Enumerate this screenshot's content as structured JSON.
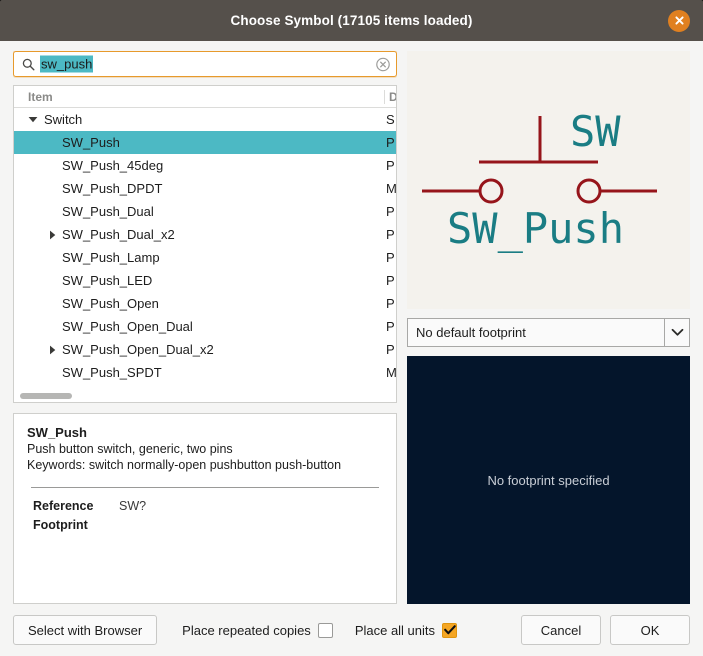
{
  "window": {
    "title": "Choose Symbol (17105 items loaded)",
    "close_icon": "close-icon"
  },
  "search": {
    "value": "sw_push",
    "placeholder": "Search",
    "search_icon": "search-icon",
    "clear_icon": "clear-icon"
  },
  "tree": {
    "columns": [
      "Item",
      "D"
    ],
    "rows": [
      {
        "label": "Switch",
        "desc": "S",
        "level": 0,
        "twisty": "expanded",
        "selected": false
      },
      {
        "label": "SW_Push",
        "desc": "P",
        "level": 1,
        "twisty": "none",
        "selected": true
      },
      {
        "label": "SW_Push_45deg",
        "desc": "P",
        "level": 1,
        "twisty": "none",
        "selected": false
      },
      {
        "label": "SW_Push_DPDT",
        "desc": "M",
        "level": 1,
        "twisty": "none",
        "selected": false
      },
      {
        "label": "SW_Push_Dual",
        "desc": "P",
        "level": 1,
        "twisty": "none",
        "selected": false
      },
      {
        "label": "SW_Push_Dual_x2",
        "desc": "P",
        "level": 1,
        "twisty": "collapsed",
        "selected": false
      },
      {
        "label": "SW_Push_Lamp",
        "desc": "P",
        "level": 1,
        "twisty": "none",
        "selected": false
      },
      {
        "label": "SW_Push_LED",
        "desc": "P",
        "level": 1,
        "twisty": "none",
        "selected": false
      },
      {
        "label": "SW_Push_Open",
        "desc": "P",
        "level": 1,
        "twisty": "none",
        "selected": false
      },
      {
        "label": "SW_Push_Open_Dual",
        "desc": "P",
        "level": 1,
        "twisty": "none",
        "selected": false
      },
      {
        "label": "SW_Push_Open_Dual_x2",
        "desc": "P",
        "level": 1,
        "twisty": "collapsed",
        "selected": false
      },
      {
        "label": "SW_Push_SPDT",
        "desc": "M",
        "level": 1,
        "twisty": "none",
        "selected": false
      }
    ]
  },
  "details": {
    "title": "SW_Push",
    "description": "Push button switch, generic, two pins",
    "keywords": "Keywords: switch normally-open pushbutton push-button",
    "fields": [
      {
        "name": "Reference",
        "value": "SW?"
      },
      {
        "name": "Footprint",
        "value": ""
      }
    ]
  },
  "symbol_preview": {
    "reference_label": "SW",
    "value_label": "SW_Push",
    "line_color": "#96151b",
    "text_color": "#1a7d84",
    "background": "#f4f2ed"
  },
  "footprint": {
    "selected": "No default footprint",
    "chevron_icon": "chevron-down-icon",
    "empty_message": "No footprint specified",
    "preview_background": "#04152b"
  },
  "bottom_bar": {
    "select_with_browser": "Select with Browser",
    "place_repeated_copies": {
      "label": "Place repeated copies",
      "checked": false
    },
    "place_all_units": {
      "label": "Place all units",
      "checked": true,
      "color": "#f5a623"
    },
    "cancel": "Cancel",
    "ok": "OK"
  }
}
